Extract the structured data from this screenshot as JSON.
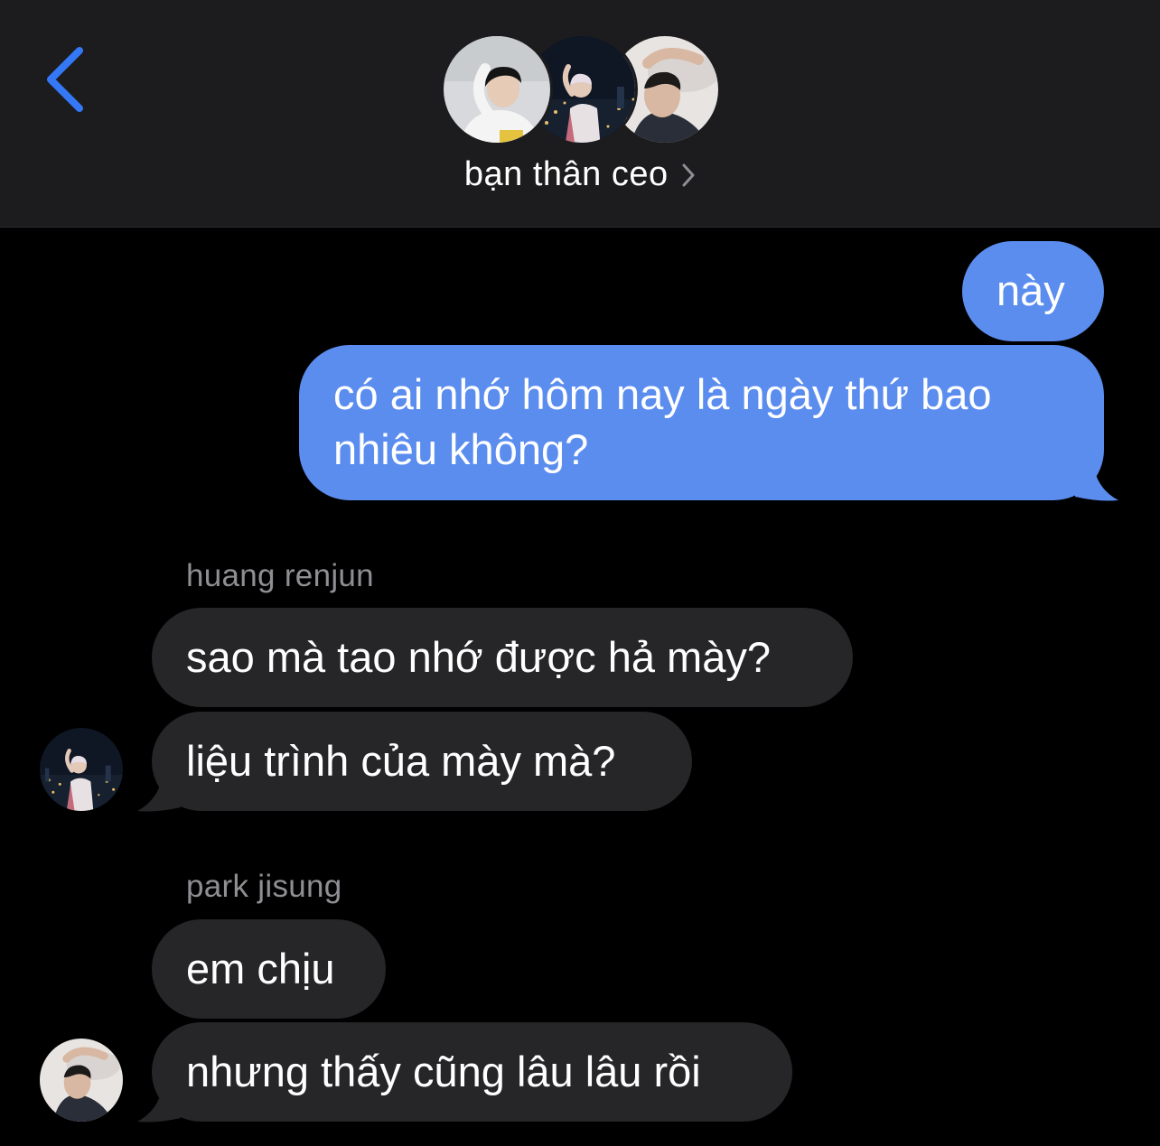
{
  "header": {
    "group_name": "bạn thân ceo",
    "back_icon": "chevron-left-icon",
    "info_icon": "chevron-right-icon",
    "participants": [
      "jisung-avatar",
      "renjun-avatar",
      "third-avatar"
    ]
  },
  "messages": [
    {
      "direction": "outgoing",
      "text": "này"
    },
    {
      "direction": "outgoing",
      "lines": [
        "có ai nhớ hôm nay là ngày thứ bao",
        "nhiêu không?"
      ]
    },
    {
      "direction": "incoming",
      "sender": "huang renjun",
      "text": "sao mà tao nhớ được hả mày?"
    },
    {
      "direction": "incoming",
      "sender": "huang renjun",
      "text": "liệu trình của mày mà?"
    },
    {
      "direction": "incoming",
      "sender": "park jisung",
      "text": "em chịu"
    },
    {
      "direction": "incoming",
      "sender": "park jisung",
      "text": "nhưng thấy cũng lâu lâu rồi"
    }
  ],
  "colors": {
    "outgoing_bubble": "#5b8def",
    "incoming_bubble": "#262629",
    "header_bg": "#1c1c1e",
    "accent": "#3478f6",
    "sender_label": "#8e8e93"
  }
}
